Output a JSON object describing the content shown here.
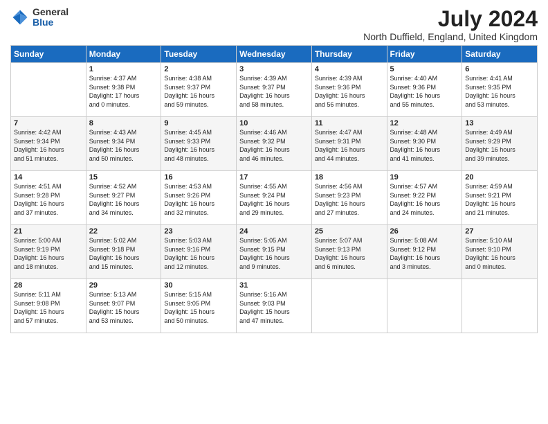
{
  "logo": {
    "general": "General",
    "blue": "Blue"
  },
  "title": {
    "month_year": "July 2024",
    "location": "North Duffield, England, United Kingdom"
  },
  "days_of_week": [
    "Sunday",
    "Monday",
    "Tuesday",
    "Wednesday",
    "Thursday",
    "Friday",
    "Saturday"
  ],
  "weeks": [
    [
      {
        "day": "",
        "info": ""
      },
      {
        "day": "1",
        "info": "Sunrise: 4:37 AM\nSunset: 9:38 PM\nDaylight: 17 hours\nand 0 minutes."
      },
      {
        "day": "2",
        "info": "Sunrise: 4:38 AM\nSunset: 9:37 PM\nDaylight: 16 hours\nand 59 minutes."
      },
      {
        "day": "3",
        "info": "Sunrise: 4:39 AM\nSunset: 9:37 PM\nDaylight: 16 hours\nand 58 minutes."
      },
      {
        "day": "4",
        "info": "Sunrise: 4:39 AM\nSunset: 9:36 PM\nDaylight: 16 hours\nand 56 minutes."
      },
      {
        "day": "5",
        "info": "Sunrise: 4:40 AM\nSunset: 9:36 PM\nDaylight: 16 hours\nand 55 minutes."
      },
      {
        "day": "6",
        "info": "Sunrise: 4:41 AM\nSunset: 9:35 PM\nDaylight: 16 hours\nand 53 minutes."
      }
    ],
    [
      {
        "day": "7",
        "info": "Sunrise: 4:42 AM\nSunset: 9:34 PM\nDaylight: 16 hours\nand 51 minutes."
      },
      {
        "day": "8",
        "info": "Sunrise: 4:43 AM\nSunset: 9:34 PM\nDaylight: 16 hours\nand 50 minutes."
      },
      {
        "day": "9",
        "info": "Sunrise: 4:45 AM\nSunset: 9:33 PM\nDaylight: 16 hours\nand 48 minutes."
      },
      {
        "day": "10",
        "info": "Sunrise: 4:46 AM\nSunset: 9:32 PM\nDaylight: 16 hours\nand 46 minutes."
      },
      {
        "day": "11",
        "info": "Sunrise: 4:47 AM\nSunset: 9:31 PM\nDaylight: 16 hours\nand 44 minutes."
      },
      {
        "day": "12",
        "info": "Sunrise: 4:48 AM\nSunset: 9:30 PM\nDaylight: 16 hours\nand 41 minutes."
      },
      {
        "day": "13",
        "info": "Sunrise: 4:49 AM\nSunset: 9:29 PM\nDaylight: 16 hours\nand 39 minutes."
      }
    ],
    [
      {
        "day": "14",
        "info": "Sunrise: 4:51 AM\nSunset: 9:28 PM\nDaylight: 16 hours\nand 37 minutes."
      },
      {
        "day": "15",
        "info": "Sunrise: 4:52 AM\nSunset: 9:27 PM\nDaylight: 16 hours\nand 34 minutes."
      },
      {
        "day": "16",
        "info": "Sunrise: 4:53 AM\nSunset: 9:26 PM\nDaylight: 16 hours\nand 32 minutes."
      },
      {
        "day": "17",
        "info": "Sunrise: 4:55 AM\nSunset: 9:24 PM\nDaylight: 16 hours\nand 29 minutes."
      },
      {
        "day": "18",
        "info": "Sunrise: 4:56 AM\nSunset: 9:23 PM\nDaylight: 16 hours\nand 27 minutes."
      },
      {
        "day": "19",
        "info": "Sunrise: 4:57 AM\nSunset: 9:22 PM\nDaylight: 16 hours\nand 24 minutes."
      },
      {
        "day": "20",
        "info": "Sunrise: 4:59 AM\nSunset: 9:21 PM\nDaylight: 16 hours\nand 21 minutes."
      }
    ],
    [
      {
        "day": "21",
        "info": "Sunrise: 5:00 AM\nSunset: 9:19 PM\nDaylight: 16 hours\nand 18 minutes."
      },
      {
        "day": "22",
        "info": "Sunrise: 5:02 AM\nSunset: 9:18 PM\nDaylight: 16 hours\nand 15 minutes."
      },
      {
        "day": "23",
        "info": "Sunrise: 5:03 AM\nSunset: 9:16 PM\nDaylight: 16 hours\nand 12 minutes."
      },
      {
        "day": "24",
        "info": "Sunrise: 5:05 AM\nSunset: 9:15 PM\nDaylight: 16 hours\nand 9 minutes."
      },
      {
        "day": "25",
        "info": "Sunrise: 5:07 AM\nSunset: 9:13 PM\nDaylight: 16 hours\nand 6 minutes."
      },
      {
        "day": "26",
        "info": "Sunrise: 5:08 AM\nSunset: 9:12 PM\nDaylight: 16 hours\nand 3 minutes."
      },
      {
        "day": "27",
        "info": "Sunrise: 5:10 AM\nSunset: 9:10 PM\nDaylight: 16 hours\nand 0 minutes."
      }
    ],
    [
      {
        "day": "28",
        "info": "Sunrise: 5:11 AM\nSunset: 9:08 PM\nDaylight: 15 hours\nand 57 minutes."
      },
      {
        "day": "29",
        "info": "Sunrise: 5:13 AM\nSunset: 9:07 PM\nDaylight: 15 hours\nand 53 minutes."
      },
      {
        "day": "30",
        "info": "Sunrise: 5:15 AM\nSunset: 9:05 PM\nDaylight: 15 hours\nand 50 minutes."
      },
      {
        "day": "31",
        "info": "Sunrise: 5:16 AM\nSunset: 9:03 PM\nDaylight: 15 hours\nand 47 minutes."
      },
      {
        "day": "",
        "info": ""
      },
      {
        "day": "",
        "info": ""
      },
      {
        "day": "",
        "info": ""
      }
    ]
  ]
}
